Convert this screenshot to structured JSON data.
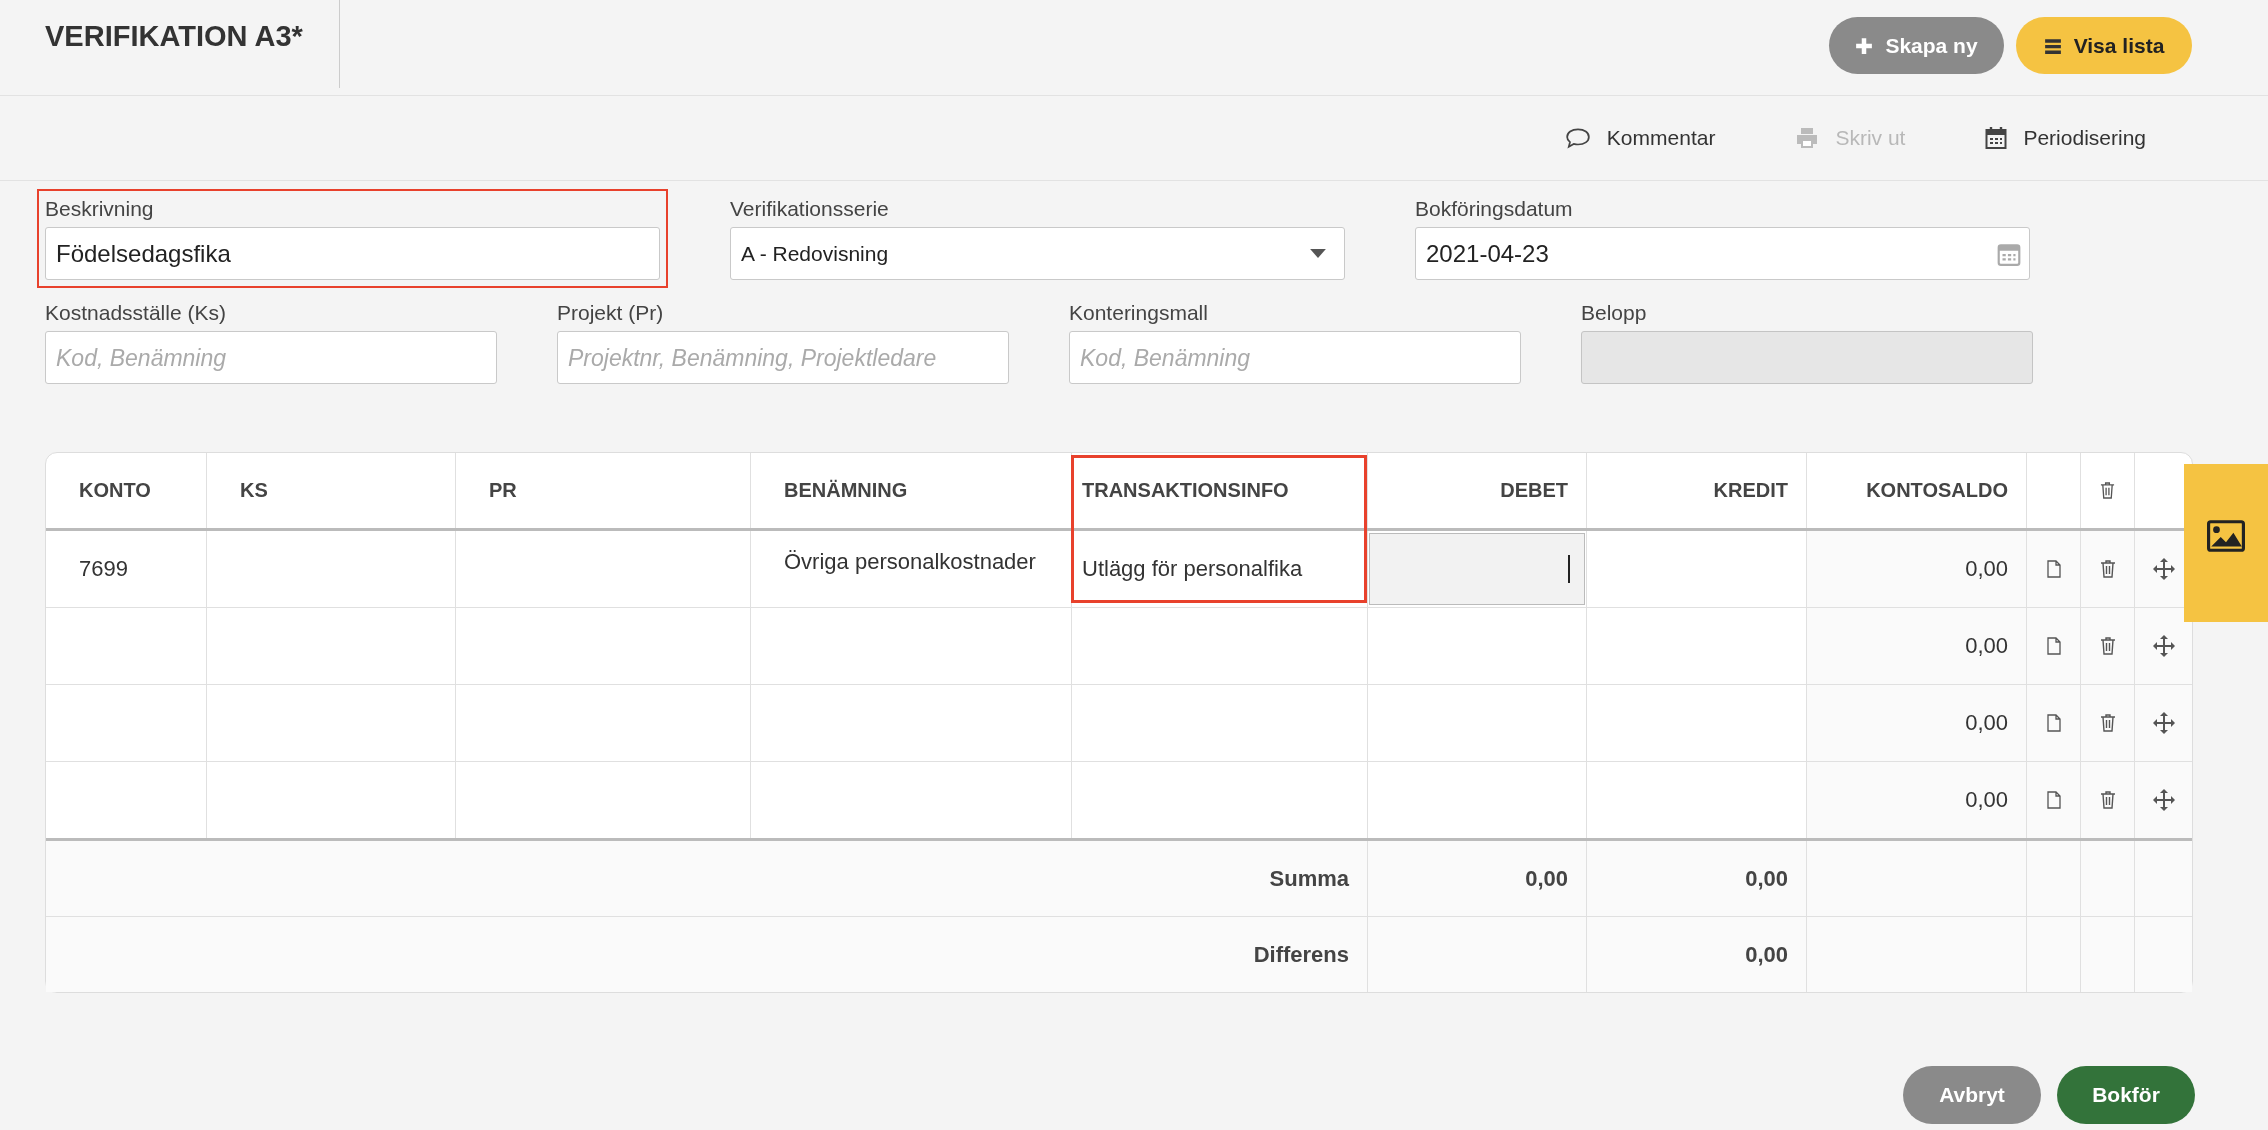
{
  "header": {
    "title": "VERIFIKATION A3*",
    "buttons": [
      {
        "label": "Skapa ny",
        "kind": "new"
      },
      {
        "label": "Visa lista",
        "kind": "list"
      }
    ]
  },
  "toolbar": [
    {
      "label": "Kommentar",
      "disabled": false
    },
    {
      "label": "Skriv ut",
      "disabled": true
    },
    {
      "label": "Periodisering",
      "disabled": false
    }
  ],
  "form_rows": [
    [
      {
        "label": "Beskrivning",
        "kind": "text",
        "value": "Födelsedagsfika",
        "highlighted": true,
        "disabled": false
      },
      {
        "label": "Verifikationsserie",
        "kind": "select",
        "value": "A - Redovisning",
        "highlighted": false,
        "disabled": false
      },
      {
        "label": "Bokföringsdatum",
        "kind": "date",
        "value": "2021-04-23",
        "highlighted": false,
        "disabled": false
      }
    ],
    [
      {
        "label": "Kostnadsställe (Ks)",
        "kind": "text",
        "placeholder": "Kod, Benämning",
        "highlighted": false,
        "disabled": false
      },
      {
        "label": "Projekt (Pr)",
        "kind": "text",
        "placeholder": "Projektnr, Benämning, Projektledare",
        "highlighted": false,
        "disabled": false
      },
      {
        "label": "Konteringsmall",
        "kind": "text",
        "placeholder": "Kod, Benämning",
        "highlighted": false,
        "disabled": false
      },
      {
        "label": "Belopp",
        "kind": "text",
        "highlighted": false,
        "disabled": true
      }
    ]
  ],
  "table": {
    "columns": [
      {
        "label": "KONTO",
        "highlighted": false
      },
      {
        "label": "KS",
        "highlighted": false
      },
      {
        "label": "PR",
        "highlighted": false
      },
      {
        "label": "BENÄMNING",
        "highlighted": false
      },
      {
        "label": "TRANSAKTIONSINFO",
        "highlighted": true
      },
      {
        "label": "DEBET",
        "highlighted": false
      },
      {
        "label": "KREDIT",
        "highlighted": false
      },
      {
        "label": "KONTOSALDO",
        "highlighted": false
      }
    ],
    "rows": [
      {
        "konto": "7699",
        "benamning": "Övriga personalkostnader",
        "transaktionsinfo": "Utlägg för personalfika",
        "kontosaldo": "0,00",
        "focused": true
      },
      {
        "kontosaldo": "0,00",
        "focused": false
      },
      {
        "kontosaldo": "0,00",
        "focused": false
      },
      {
        "kontosaldo": "0,00",
        "focused": false
      }
    ],
    "totals": [
      {
        "label": "Summa",
        "debet": "0,00",
        "kredit": "0,00"
      },
      {
        "label": "Differens",
        "kredit": "0,00"
      }
    ]
  },
  "footer_buttons": [
    {
      "label": "Avbryt",
      "kind": "cancel"
    },
    {
      "label": "Bokför",
      "kind": "primary"
    }
  ]
}
